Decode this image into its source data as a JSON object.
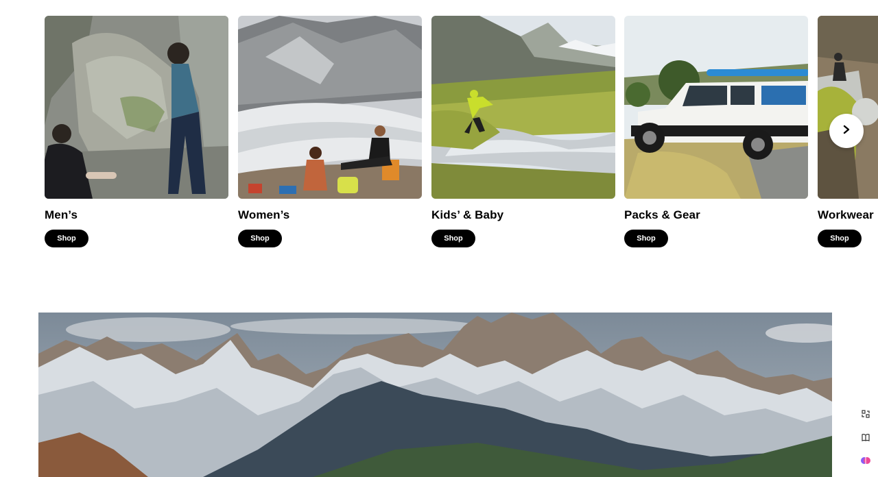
{
  "categories": [
    {
      "title": "Men’s",
      "cta": "Shop"
    },
    {
      "title": "Women’s",
      "cta": "Shop"
    },
    {
      "title": "Kids’ & Baby",
      "cta": "Shop"
    },
    {
      "title": "Packs & Gear",
      "cta": "Shop"
    },
    {
      "title": "Workwear",
      "cta": "Shop"
    }
  ],
  "carousel": {
    "next_icon": "chevron-right-icon"
  },
  "side_tools": [
    "translate-icon",
    "book-icon",
    "brain-icon"
  ],
  "colors": {
    "button_bg": "#000000",
    "button_text": "#ffffff"
  }
}
